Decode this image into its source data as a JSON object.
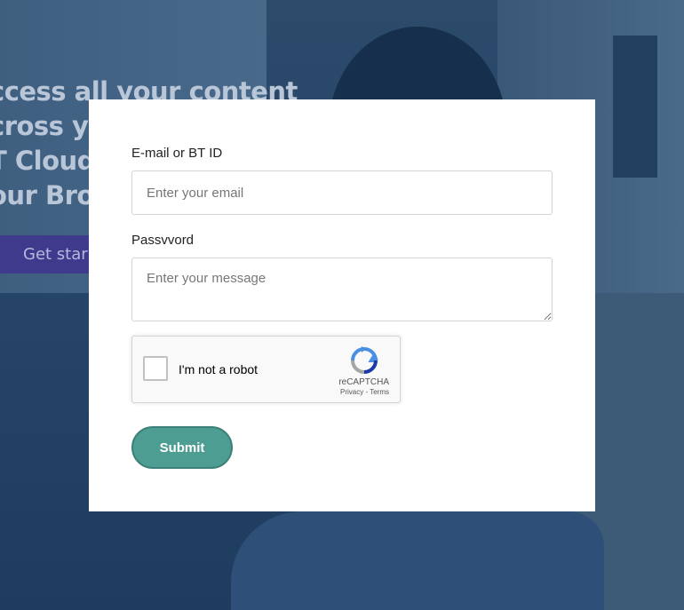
{
  "background": {
    "promo_lines": [
      "ccess all your content",
      "cross yo",
      "T Cloud",
      "our Broc"
    ],
    "promo_button_label": "Get star"
  },
  "form": {
    "email_label": "E-mail or BT ID",
    "email_placeholder": "Enter your email",
    "email_value": "",
    "password_label": "Passvvord",
    "password_placeholder": "Enter your message",
    "password_value": "",
    "captcha": {
      "label": "I'm not a robot",
      "brand": "reCAPTCHA",
      "privacy_label": "Privacy",
      "separator": " - ",
      "terms_label": "Terms",
      "checked": false
    },
    "submit_label": "Submit"
  },
  "colors": {
    "accent": "#4e9d93",
    "overlay": "#274669",
    "promo_button": "#3f3a8c"
  }
}
